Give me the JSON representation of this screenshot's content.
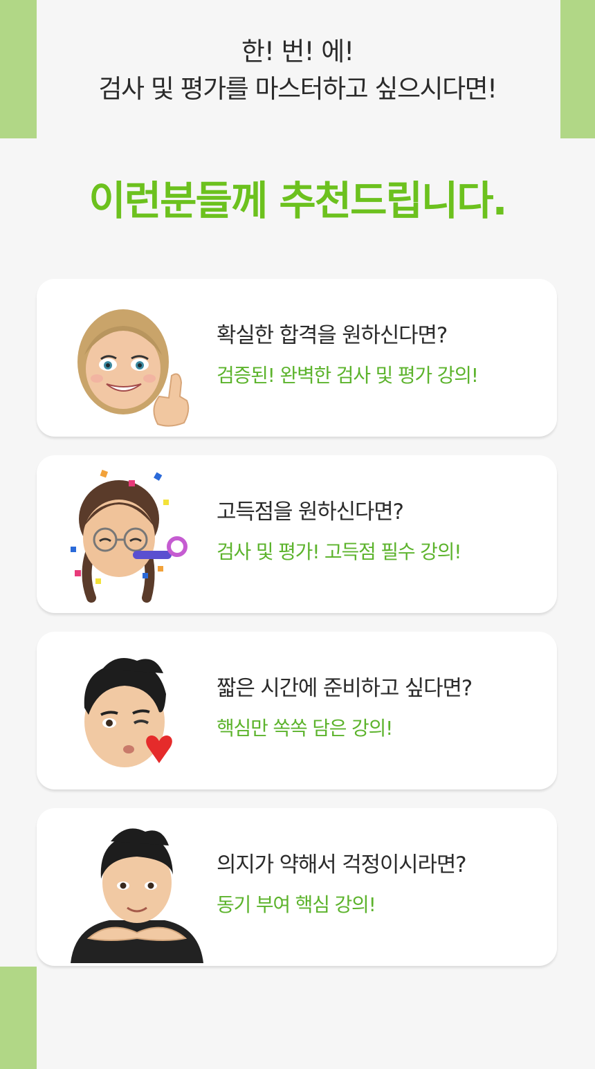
{
  "intro": {
    "line1": "한! 번! 에!",
    "line2": "검사 및 평가를 마스터하고 싶으시다면!"
  },
  "headline": "이런분들께 추천드립니다.",
  "cards": [
    {
      "question": "확실한 합격을 원하신다면?",
      "answer": "검증된! 완벽한 검사 및 평가 강의!",
      "avatar": "thumbs-up-girl-emoji"
    },
    {
      "question": "고득점을 원하신다면?",
      "answer": "검사 및 평가! 고득점 필수 강의!",
      "avatar": "party-braids-emoji"
    },
    {
      "question": "짧은 시간에 준비하고 싶다면?",
      "answer": "핵심만 쏙쏙 담은 강의!",
      "avatar": "wink-heart-boy-emoji"
    },
    {
      "question": "의지가 약해서 걱정이시라면?",
      "answer": "동기 부여 핵심 강의!",
      "avatar": "face-frame-boy-emoji"
    }
  ],
  "colors": {
    "accent_green": "#6cc11e",
    "answer_green": "#5cb32c",
    "side_bar": "#b1d786",
    "background": "#f6f6f6"
  }
}
